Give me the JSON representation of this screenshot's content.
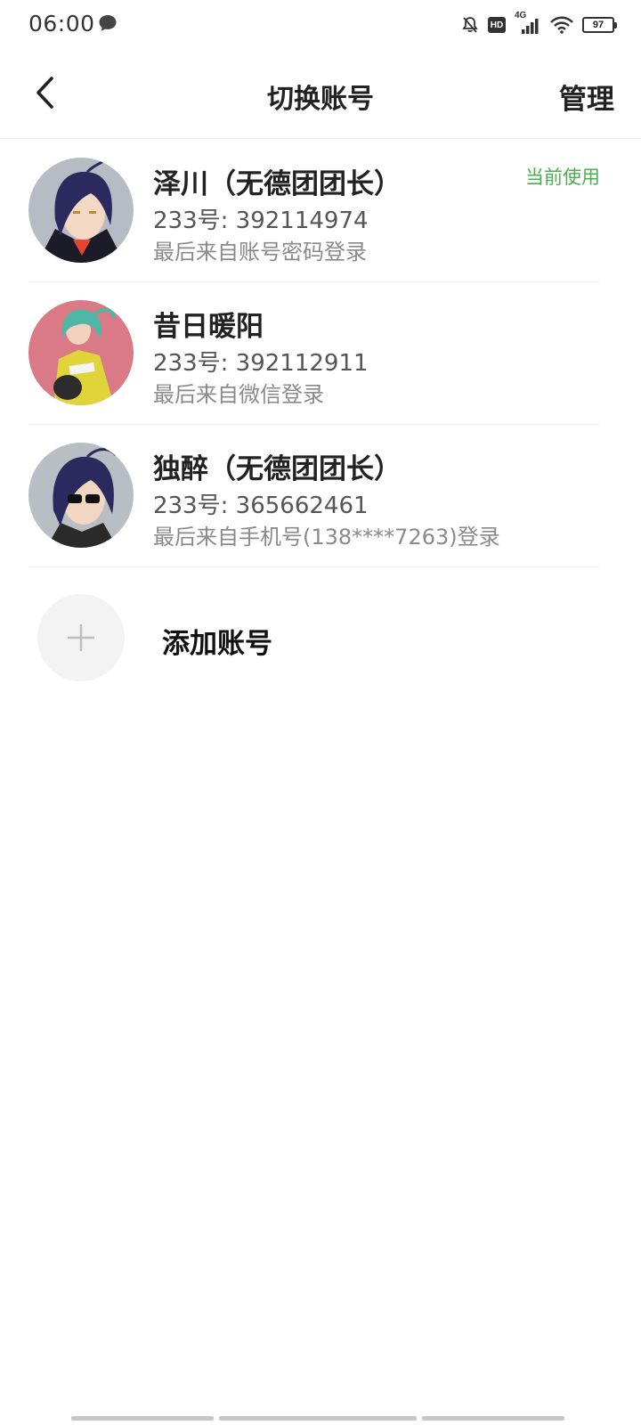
{
  "status_bar": {
    "time": "06:00",
    "network": "4G",
    "hd": "HD",
    "battery": "97"
  },
  "header": {
    "title": "切换账号",
    "manage": "管理",
    "back_icon": "chevron-left-icon"
  },
  "accounts": [
    {
      "name": "泽川（无德团团长）",
      "id": "233号: 392114974",
      "login": "最后来自账号密码登录",
      "current": "当前使用"
    },
    {
      "name": "昔日暖阳",
      "id": "233号: 392112911",
      "login": "最后来自微信登录"
    },
    {
      "name": "独醉（无德团团长）",
      "id": "233号: 365662461",
      "login": "最后来自手机号(138****7263)登录"
    }
  ],
  "add_account": {
    "label": "添加账号",
    "icon": "plus-icon"
  },
  "colors": {
    "current_tag": "#4caf50",
    "divider": "#ececec",
    "add_circle": "#f3f3f3"
  }
}
